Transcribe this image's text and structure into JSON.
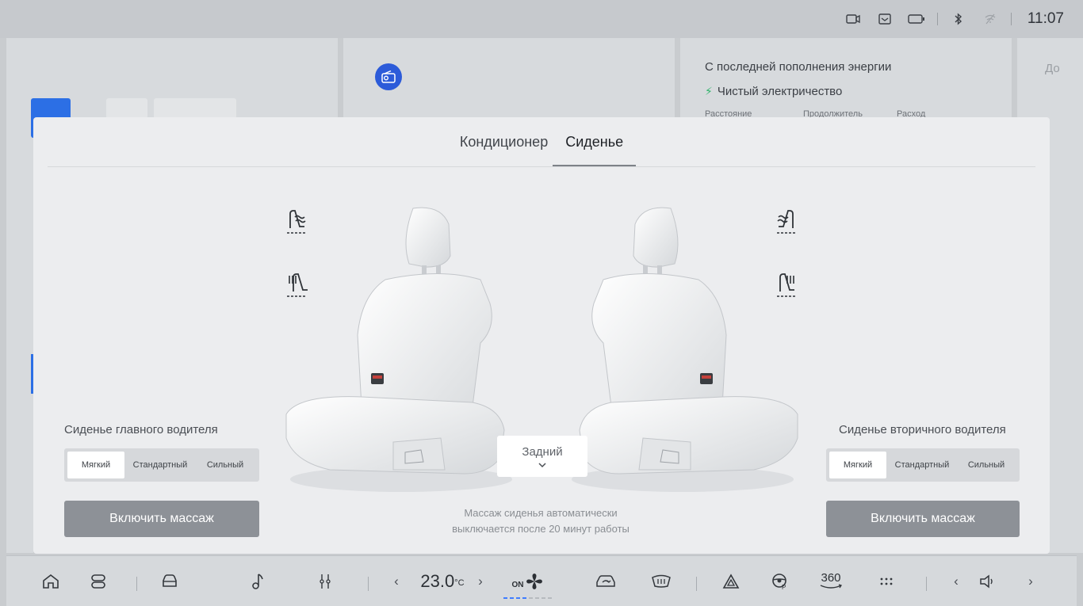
{
  "status_bar": {
    "time": "11:07",
    "icons": [
      "dashcam-icon",
      "message-icon",
      "battery-icon",
      "bluetooth-icon",
      "wifi-off-icon"
    ]
  },
  "background": {
    "energy_title": "С последней пополнения энергии",
    "energy_mode": "Чистый электричество",
    "energy_cols": [
      "Расстояние",
      "Продолжитель",
      "Расход"
    ],
    "right_fragment": "До"
  },
  "modal": {
    "tabs": [
      "Кондиционер",
      "Сиденье"
    ],
    "active_tab": 1,
    "driver": {
      "title": "Сиденье главного водителя",
      "levels": [
        "Мягкий",
        "Стандартный",
        "Сильный"
      ],
      "selected": 0,
      "massage_label": "Включить массаж"
    },
    "passenger": {
      "title": "Сиденье вторичного водителя",
      "levels": [
        "Мягкий",
        "Стандартный",
        "Сильный"
      ],
      "selected": 0,
      "massage_label": "Включить массаж"
    },
    "rear_label": "Задний",
    "note_line1": "Массаж сиденья автоматически",
    "note_line2": "выключается после 20 минут работы"
  },
  "dock": {
    "temperature": "23.0",
    "temp_unit": "°C",
    "fan_on_label": "ON",
    "fan_level": 0.33,
    "camera_label": "360",
    "items": [
      "home-icon",
      "apps-icon",
      "car-icon",
      "music-icon",
      "seat-control-icon",
      "fan-icon",
      "car-recirculation-icon",
      "rear-defrost-icon",
      "hazard-icon",
      "steering-heat-icon",
      "camera-360-icon",
      "more-icon",
      "volume-icon"
    ]
  }
}
